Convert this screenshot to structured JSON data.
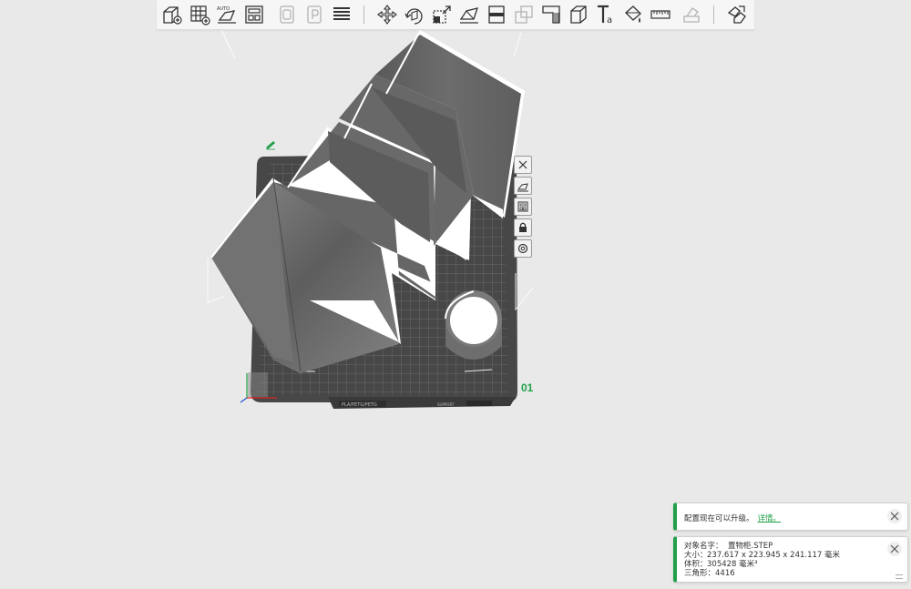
{
  "toolbar": {
    "buttons": [
      {
        "icon": "add-object-icon",
        "enabled": true
      },
      {
        "icon": "add-plate-icon",
        "enabled": true
      },
      {
        "icon": "auto-orient-icon",
        "enabled": true
      },
      {
        "icon": "arrange-icon",
        "enabled": true
      },
      {
        "icon": "copy-icon",
        "enabled": false
      },
      {
        "icon": "paste-icon",
        "enabled": false
      },
      {
        "icon": "layers-icon",
        "enabled": true
      },
      {
        "icon": "move-icon",
        "enabled": true
      },
      {
        "icon": "rotate-icon",
        "enabled": true
      },
      {
        "icon": "scale-icon",
        "enabled": true
      },
      {
        "icon": "lay-on-face-icon",
        "enabled": true
      },
      {
        "icon": "cut-icon",
        "enabled": true
      },
      {
        "icon": "boolean-icon",
        "enabled": false
      },
      {
        "icon": "support-paint-icon",
        "enabled": true
      },
      {
        "icon": "seam-paint-icon",
        "enabled": true
      },
      {
        "icon": "text-icon",
        "enabled": true
      },
      {
        "icon": "color-paint-icon",
        "enabled": true
      },
      {
        "icon": "measure-icon",
        "enabled": true
      },
      {
        "icon": "assembly-icon",
        "enabled": false
      },
      {
        "icon": "assembly-view-icon",
        "enabled": true
      }
    ]
  },
  "side_toolbar": [
    {
      "icon": "delete-icon"
    },
    {
      "icon": "auto-orient-plate-icon"
    },
    {
      "icon": "arrange-plate-icon"
    },
    {
      "icon": "lock-icon"
    },
    {
      "icon": "settings-icon"
    }
  ],
  "plate": {
    "number": "01",
    "bed_label": "PLA/PETG/PETG",
    "bed_label_2": "SUPPORT"
  },
  "notifications": {
    "update": {
      "text": "配置现在可以升级。",
      "link": "详情。"
    },
    "object_info": {
      "name_label": "对象名字：",
      "name_value": "置物柜.STEP",
      "size_label": "大小：",
      "size_value": "237.617 x 223.945 x 241.117 毫米",
      "volume_label": "体积：",
      "volume_value": "305428 毫米³",
      "triangles_label": "三角形：",
      "triangles_value": "4416"
    }
  },
  "colors": {
    "accent": "#21a048",
    "background": "#e9e9e9",
    "bed": "#4a4a4a",
    "model": "#6f6f6f"
  }
}
